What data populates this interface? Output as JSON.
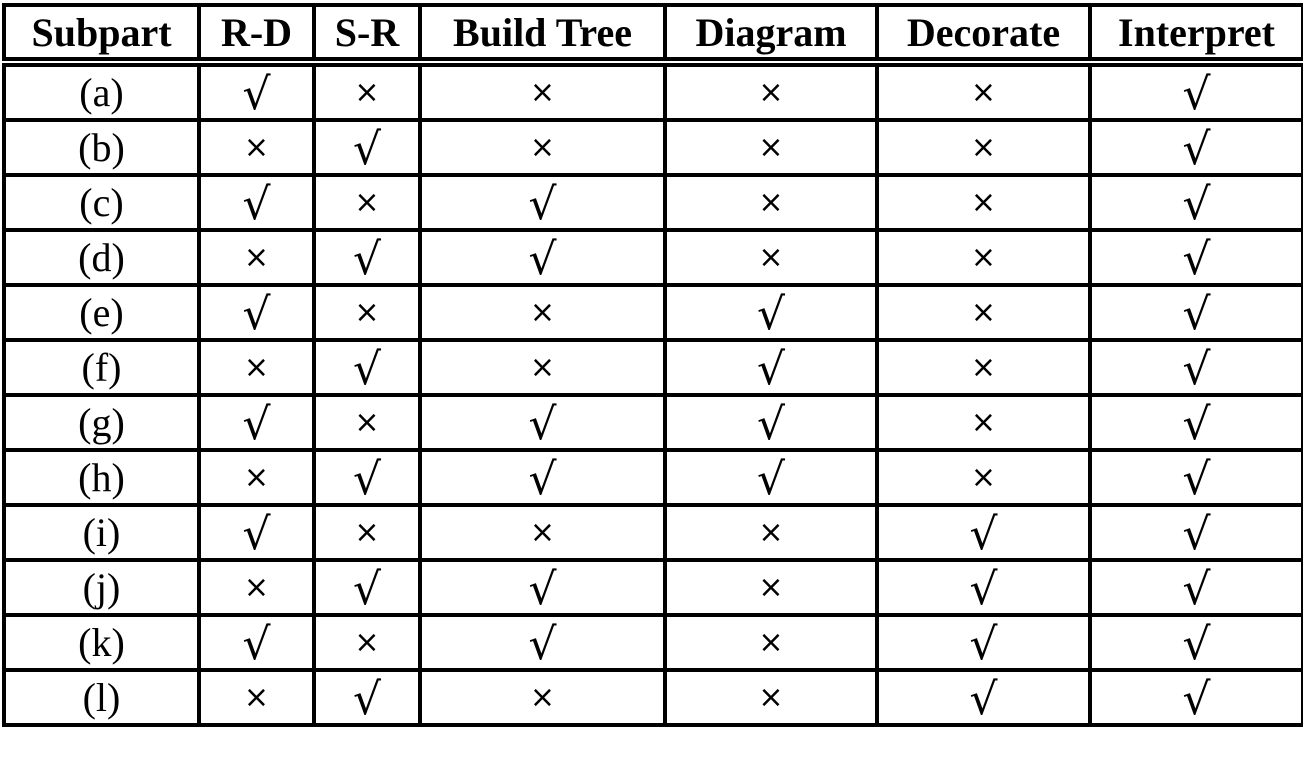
{
  "table": {
    "headers": [
      "Subpart",
      "R-D",
      "S-R",
      "Build Tree",
      "Diagram",
      "Decorate",
      "Interpret"
    ],
    "symbols": {
      "yes": "√",
      "no": "×",
      "yes_icon": "check-icon",
      "no_icon": "cross-icon"
    },
    "rows": [
      {
        "subpart": "(a)",
        "values": [
          true,
          false,
          false,
          false,
          false,
          true
        ]
      },
      {
        "subpart": "(b)",
        "values": [
          false,
          true,
          false,
          false,
          false,
          true
        ]
      },
      {
        "subpart": "(c)",
        "values": [
          true,
          false,
          true,
          false,
          false,
          true
        ]
      },
      {
        "subpart": "(d)",
        "values": [
          false,
          true,
          true,
          false,
          false,
          true
        ]
      },
      {
        "subpart": "(e)",
        "values": [
          true,
          false,
          false,
          true,
          false,
          true
        ]
      },
      {
        "subpart": "(f)",
        "values": [
          false,
          true,
          false,
          true,
          false,
          true
        ]
      },
      {
        "subpart": "(g)",
        "values": [
          true,
          false,
          true,
          true,
          false,
          true
        ]
      },
      {
        "subpart": "(h)",
        "values": [
          false,
          true,
          true,
          true,
          false,
          true
        ]
      },
      {
        "subpart": "(i)",
        "values": [
          true,
          false,
          false,
          false,
          true,
          true
        ]
      },
      {
        "subpart": "(j)",
        "values": [
          false,
          true,
          true,
          false,
          true,
          true
        ]
      },
      {
        "subpart": "(k)",
        "values": [
          true,
          false,
          true,
          false,
          true,
          true
        ]
      },
      {
        "subpart": "(l)",
        "values": [
          false,
          true,
          false,
          false,
          true,
          true
        ]
      }
    ]
  }
}
